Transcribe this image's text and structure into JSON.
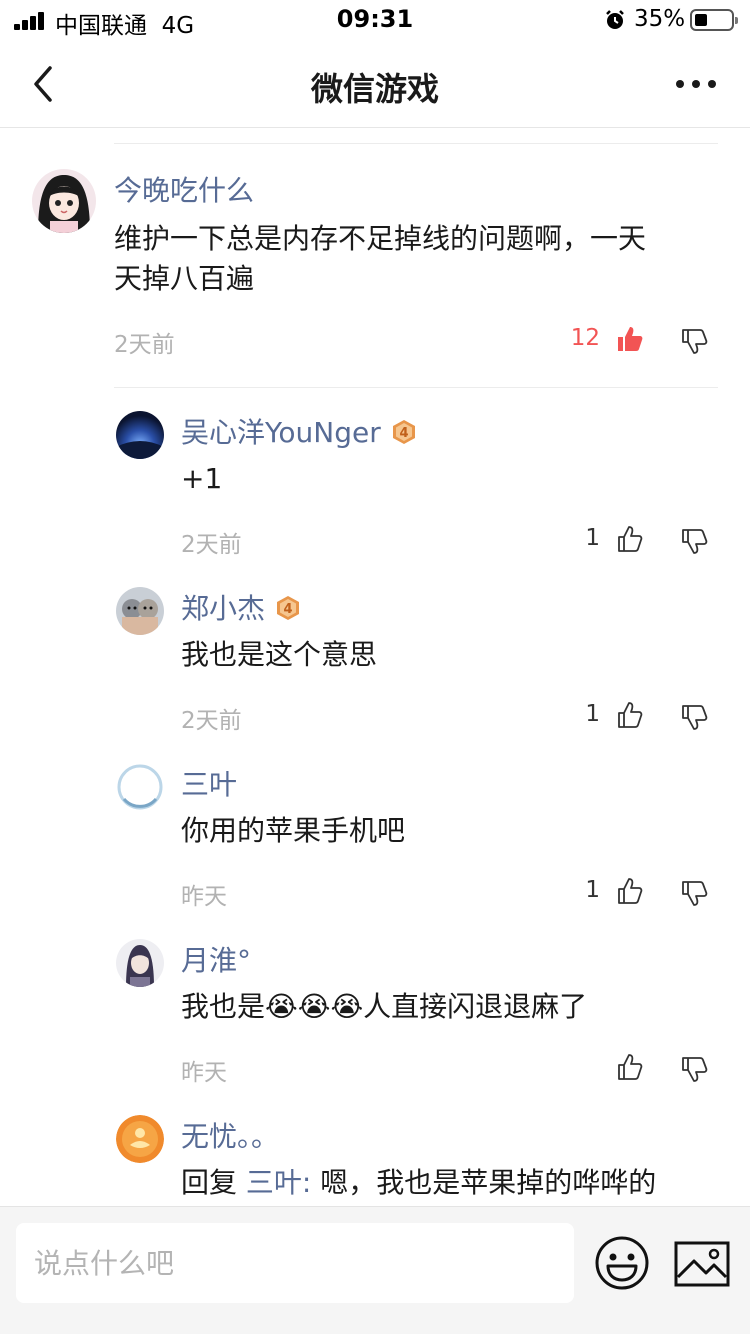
{
  "status_bar": {
    "carrier": "中国联通",
    "network": "4G",
    "time": "09:31",
    "battery": "35%"
  },
  "nav": {
    "title": "微信游戏"
  },
  "comments": [
    {
      "name": "今晚吃什么",
      "text_lines": [
        "维护一下总是内存不足掉线的问题啊，一天",
        "天掉八百遍"
      ],
      "time": "2天前",
      "likes": "12",
      "liked": true
    }
  ],
  "replies": [
    {
      "name": "吴心洋YouNger",
      "badge": "4",
      "text": "+1",
      "time": "2天前",
      "likes": "1"
    },
    {
      "name": "郑小杰",
      "badge": "4",
      "text": "我也是这个意思",
      "time": "2天前",
      "likes": "1"
    },
    {
      "name": "三叶",
      "text": "你用的苹果手机吧",
      "time": "昨天",
      "likes": "1"
    },
    {
      "name": "月淮°",
      "text_prefix": "我也是",
      "emoji": "😭😭😭",
      "text_suffix": "人直接闪退退麻了",
      "time": "昨天",
      "likes": ""
    },
    {
      "name": "无忧。。",
      "reply_prefix": "回复 ",
      "reply_to": "三叶:",
      "text": " 嗯，我也是苹果掉的哗哗的"
    }
  ],
  "bottom_bar": {
    "input_placeholder": "说点什么吧"
  },
  "icons": {
    "back": "back-arrow-icon",
    "more": "more-dots-icon",
    "like": "thumbs-up-icon",
    "dislike": "thumbs-down-icon",
    "emoji": "smiley-icon",
    "image": "image-icon"
  },
  "colors": {
    "link": "#576b95",
    "liked": "#f25454",
    "muted": "#b2b2b2"
  }
}
